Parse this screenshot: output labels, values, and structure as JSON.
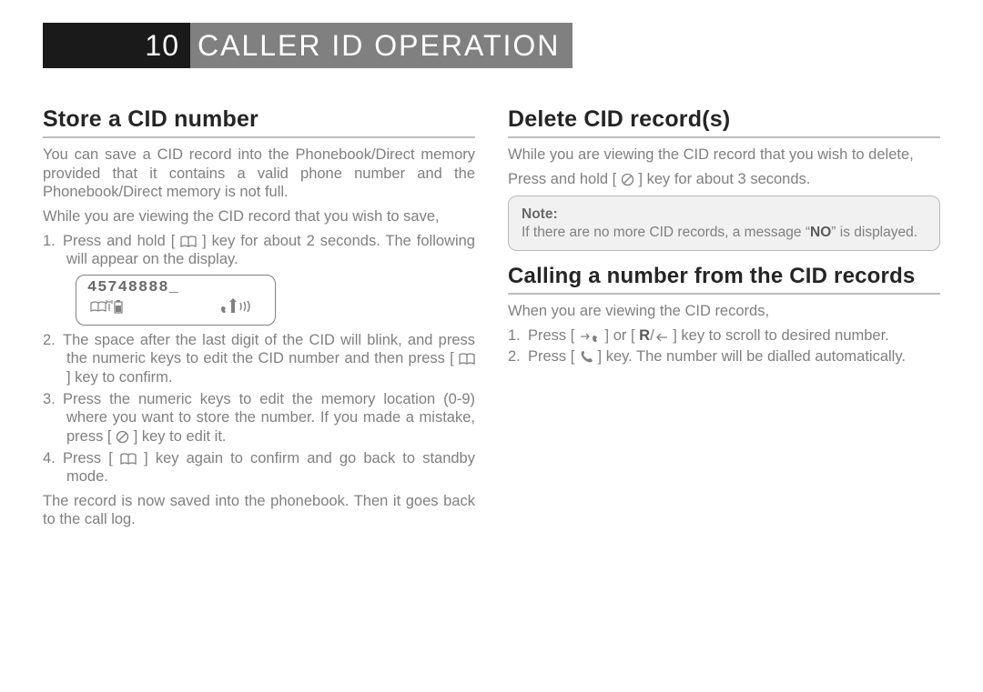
{
  "header": {
    "page_number": "10",
    "title": "CALLER ID OPERATION"
  },
  "left": {
    "heading": "Store a CID number",
    "intro": "You can save a CID record into the Phonebook/Direct memory provided that it contains a valid phone number and the Phonebook/Direct memory is not full.",
    "line2": "While you are viewing the CID record that you wish to save,",
    "step1_a": "1. Press and hold [ ",
    "step1_b": " ] key for about 2 seconds. The following will appear on the display.",
    "lcd_number": "45748888_",
    "step2": "2. The space after the last digit of the CID will blink, and press the numeric keys to edit the CID number and then press [ ",
    "step2_b": " ] key to confirm.",
    "step3": "3. Press the numeric keys to edit the memory location (0-9) where you want to store the number. If you made a mistake, press [ ",
    "step3_b": " ] key to edit it.",
    "step4": "4. Press [ ",
    "step4_b": " ] key again to confirm and go back to standby mode.",
    "outro": "The record is now saved into the phonebook. Then it goes back to the call log."
  },
  "right": {
    "heading1": "Delete CID record(s)",
    "p1": "While you are viewing the CID record that you wish to delete,",
    "p2_a": "Press and hold [ ",
    "p2_b": " ] key for about 3 seconds.",
    "note_label": "Note:",
    "note_a": "If there are no more CID records, a message “",
    "note_no": "NO",
    "note_b": "” is displayed.",
    "heading2": "Calling a number from the CID records",
    "p3": "When you are viewing the CID records,",
    "s1_a": "1. Press [ ",
    "s1_b": " ] or [ ",
    "s1_r": "R",
    "s1_c": "/",
    "s1_d": " ] key to scroll to desired number.",
    "s2_a": "2. Press [ ",
    "s2_b": " ] key. The number will be dialled automatically."
  }
}
